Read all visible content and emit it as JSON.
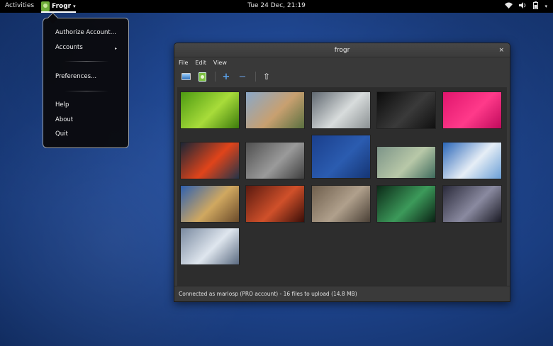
{
  "topbar": {
    "activities": "Activities",
    "app_name": "Frogr",
    "app_caret": "▾",
    "clock": "Tue 24 Dec, 21:19",
    "tray": {
      "wifi": "wifi-icon",
      "volume": "volume-icon",
      "battery": "battery-icon",
      "caret": "▾"
    }
  },
  "app_menu": {
    "items": [
      "Authorize Account...",
      "Accounts",
      "Preferences...",
      "Help",
      "About",
      "Quit"
    ],
    "submenu_arrow": "▸"
  },
  "window": {
    "title": "frogr",
    "close": "×",
    "menubar": [
      "File",
      "Edit",
      "View"
    ],
    "toolbar": {
      "add_pictures_icon": "photo-icon",
      "upload_icon": "upload-icon",
      "plus": "+",
      "minus": "−",
      "up": "⇧"
    },
    "status": "Connected as mariosp (PRO account) - 16 files to upload (14.8 MB)"
  },
  "thumbnails": [
    {
      "name": "green-leaf",
      "colors": [
        "#4d9a12",
        "#a8dc3a",
        "#3c7a0c"
      ]
    },
    {
      "name": "grass-seeds",
      "colors": [
        "#8aa8c8",
        "#c8a070",
        "#5a7040"
      ]
    },
    {
      "name": "dandelion",
      "colors": [
        "#606870",
        "#d8dcdc",
        "#8a9092"
      ]
    },
    {
      "name": "dark-leaves",
      "colors": [
        "#0c0c0c",
        "#3a3a3a",
        "#101010"
      ]
    },
    {
      "name": "pink-fabric",
      "colors": [
        "#e0156d",
        "#ff3a8a",
        "#c00a5c"
      ]
    },
    {
      "name": "red-berries",
      "colors": [
        "#1a2636",
        "#e0441a",
        "#233448"
      ]
    },
    {
      "name": "water-drops",
      "colors": [
        "#505050",
        "#9a9a9a",
        "#3e3e3e"
      ]
    },
    {
      "name": "blue-abstract",
      "colors": [
        "#1a3f8c",
        "#2b5cb0",
        "#153574"
      ]
    },
    {
      "name": "green-stripes",
      "colors": [
        "#7c9488",
        "#b8c8a8",
        "#3e6a5c"
      ]
    },
    {
      "name": "blue-sky-clouds",
      "colors": [
        "#2a66b8",
        "#e6eef6",
        "#6a9ed6"
      ]
    },
    {
      "name": "desert-road",
      "colors": [
        "#2e60b0",
        "#d0a860",
        "#6a4a2a"
      ]
    },
    {
      "name": "red-canyon",
      "colors": [
        "#5a1a10",
        "#d0502a",
        "#3a0e08"
      ]
    },
    {
      "name": "pebbles",
      "colors": [
        "#6e5e4c",
        "#b0a08c",
        "#4a4036"
      ]
    },
    {
      "name": "green-glow",
      "colors": [
        "#0c2a18",
        "#3c9a5a",
        "#0a2214"
      ]
    },
    {
      "name": "sunset-beach",
      "colors": [
        "#2a2a3a",
        "#8a8aa0",
        "#1a1a24"
      ]
    },
    {
      "name": "frosted-grass",
      "colors": [
        "#7a8aa0",
        "#dfe6ee",
        "#5a6a80"
      ]
    }
  ]
}
